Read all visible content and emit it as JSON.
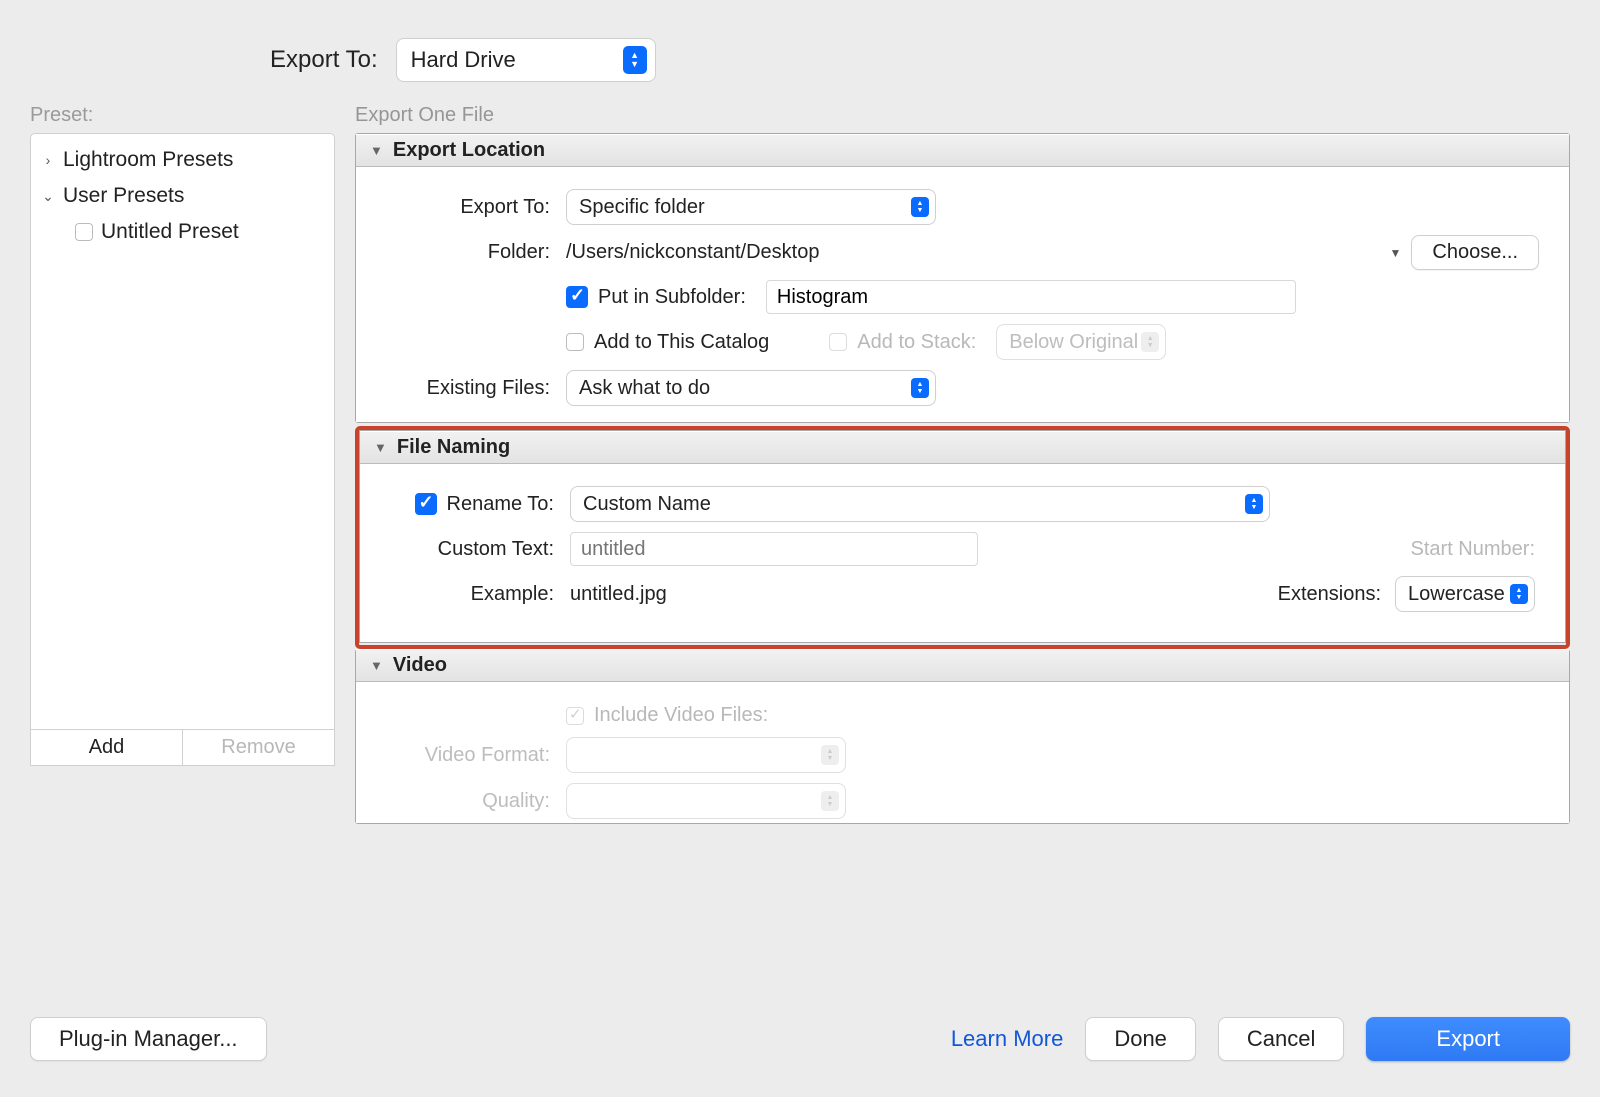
{
  "top": {
    "label": "Export To:",
    "value": "Hard Drive"
  },
  "presets": {
    "header": "Preset:",
    "groups": [
      {
        "caret": "›",
        "label": "Lightroom Presets"
      },
      {
        "caret": "⌄",
        "label": "User Presets"
      }
    ],
    "items": [
      {
        "label": "Untitled Preset"
      }
    ],
    "add": "Add",
    "remove": "Remove"
  },
  "main": {
    "title": "Export One File",
    "location": {
      "header": "Export Location",
      "export_to_label": "Export To:",
      "export_to_value": "Specific folder",
      "folder_label": "Folder:",
      "folder_path": "/Users/nickconstant/Desktop",
      "choose": "Choose...",
      "subfolder_label": "Put in Subfolder:",
      "subfolder_value": "Histogram",
      "add_catalog": "Add to This Catalog",
      "add_stack_label": "Add to Stack:",
      "add_stack_value": "Below Original",
      "existing_label": "Existing Files:",
      "existing_value": "Ask what to do"
    },
    "naming": {
      "header": "File Naming",
      "rename_label": "Rename To:",
      "rename_value": "Custom Name",
      "custom_text_label": "Custom Text:",
      "custom_text_placeholder": "untitled",
      "start_number_label": "Start Number:",
      "example_label": "Example:",
      "example_value": "untitled.jpg",
      "extensions_label": "Extensions:",
      "extensions_value": "Lowercase"
    },
    "video": {
      "header": "Video",
      "include_label": "Include Video Files:",
      "format_label": "Video Format:",
      "quality_label": "Quality:"
    }
  },
  "footer": {
    "plugin": "Plug-in Manager...",
    "learn": "Learn More",
    "done": "Done",
    "cancel": "Cancel",
    "export": "Export"
  }
}
